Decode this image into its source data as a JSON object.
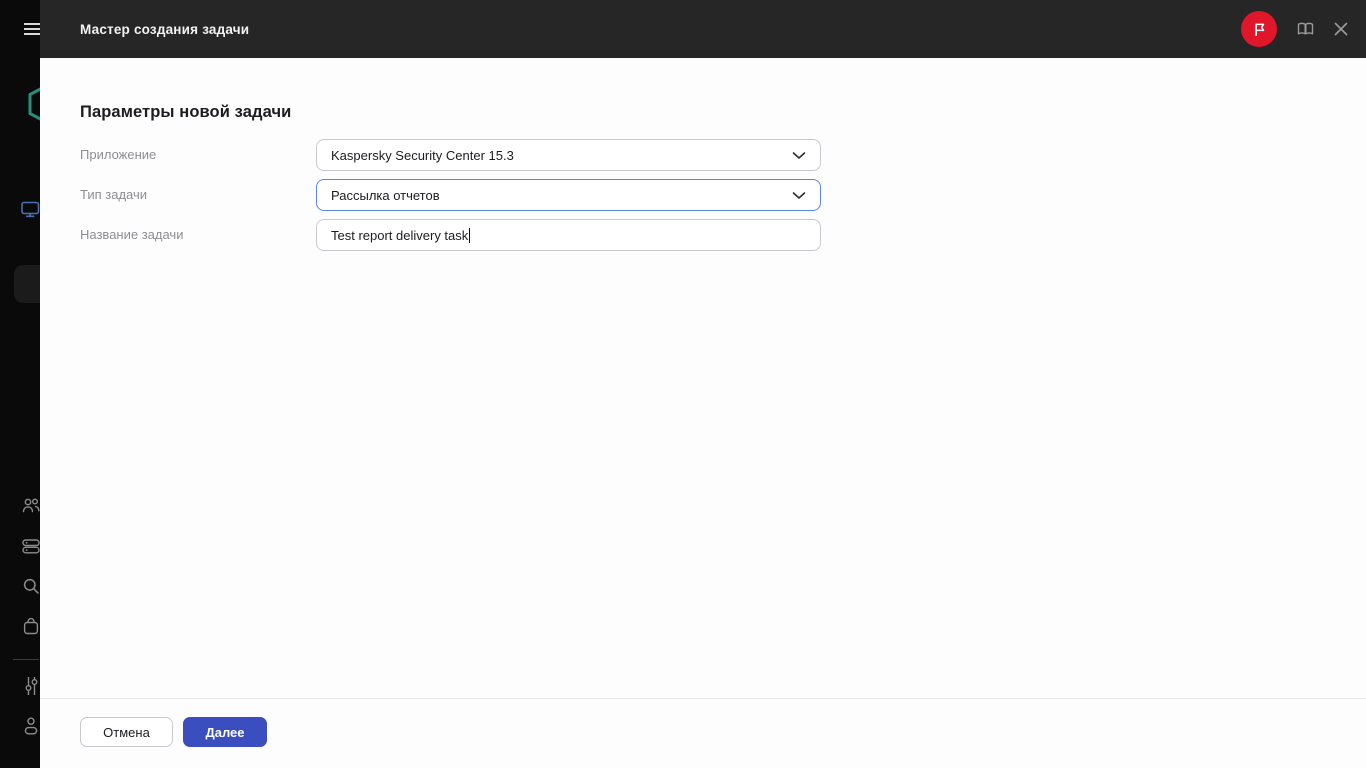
{
  "header": {
    "title": "Мастер создания задачи"
  },
  "wizard": {
    "title": "Параметры новой задачи",
    "fields": [
      {
        "label": "Приложение",
        "value": "Kaspersky Security Center 15.3",
        "type": "select",
        "focused": false
      },
      {
        "label": "Тип задачи",
        "value": "Рассылка отчетов",
        "type": "select",
        "focused": true
      },
      {
        "label": "Название задачи",
        "value": "Test report delivery task",
        "type": "text",
        "caret_visible": true
      }
    ],
    "footer": {
      "cancel_label": "Отмена",
      "next_label": "Далее"
    }
  },
  "icons": [
    "menu-icon",
    "kaspersky-hexagon-logo",
    "monitoring-icon",
    "users-icon",
    "devices-icon",
    "search-icon",
    "marketplace-icon",
    "settings-sliders-icon",
    "account-icon",
    "flag-icon",
    "help-book-icon",
    "close-icon",
    "chevron-down-icon"
  ],
  "colors": {
    "sidebar_bg": "#0a0a0a",
    "header_bg": "#262626",
    "panel_bg": "#fdfdfd",
    "brand_red": "#e0162b",
    "brand_teal": "#2a8c7d",
    "monitor_blue": "#4a70b2",
    "focus_border": "#5a86e8",
    "primary_button": "#3b4ec0",
    "field_border": "#c9c9cf",
    "label_gray": "#8d8d95"
  }
}
